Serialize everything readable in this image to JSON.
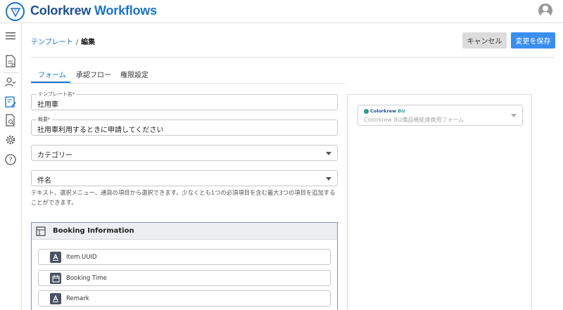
{
  "app": {
    "brand_main": "Colorkrew",
    "brand_sub": "Workflows"
  },
  "breadcrumb": {
    "link": "テンプレート",
    "separator": "/",
    "current": "編集"
  },
  "actions": {
    "cancel_label": "キャンセル",
    "save_label": "変更を保存"
  },
  "tabs": [
    {
      "label": "フォーム",
      "active": true
    },
    {
      "label": "承認フロー",
      "active": false
    },
    {
      "label": "権限設定",
      "active": false
    }
  ],
  "form": {
    "template_name": {
      "label": "テンプレート名*",
      "value": "社用車"
    },
    "summary": {
      "label": "概要*",
      "value": "社用車利用するときに申請してください"
    },
    "category": {
      "value": "カテゴリー"
    },
    "subject": {
      "value": "件名"
    },
    "help_text": "テキスト、選択メニュー、通貨の項目から選択できます。少なくとも1つの必須項目を含む最大3つの項目を追加することができます。"
  },
  "section": {
    "title": "Booking Information",
    "items": [
      {
        "label": "Item UUID",
        "icon": "text-format-icon"
      },
      {
        "label": "Booking Time",
        "icon": "calendar-icon"
      },
      {
        "label": "Remark",
        "icon": "text-format-icon"
      }
    ]
  },
  "right_panel": {
    "logo_text": "Colorkrew",
    "logo_biz": "Biz",
    "select_value": "Colorkrew Biz備品機能連携用フォーム"
  },
  "colors": {
    "accent": "#1a74c9",
    "save_button": "#3a8ef0",
    "brand_dark": "#1d4f8f"
  }
}
